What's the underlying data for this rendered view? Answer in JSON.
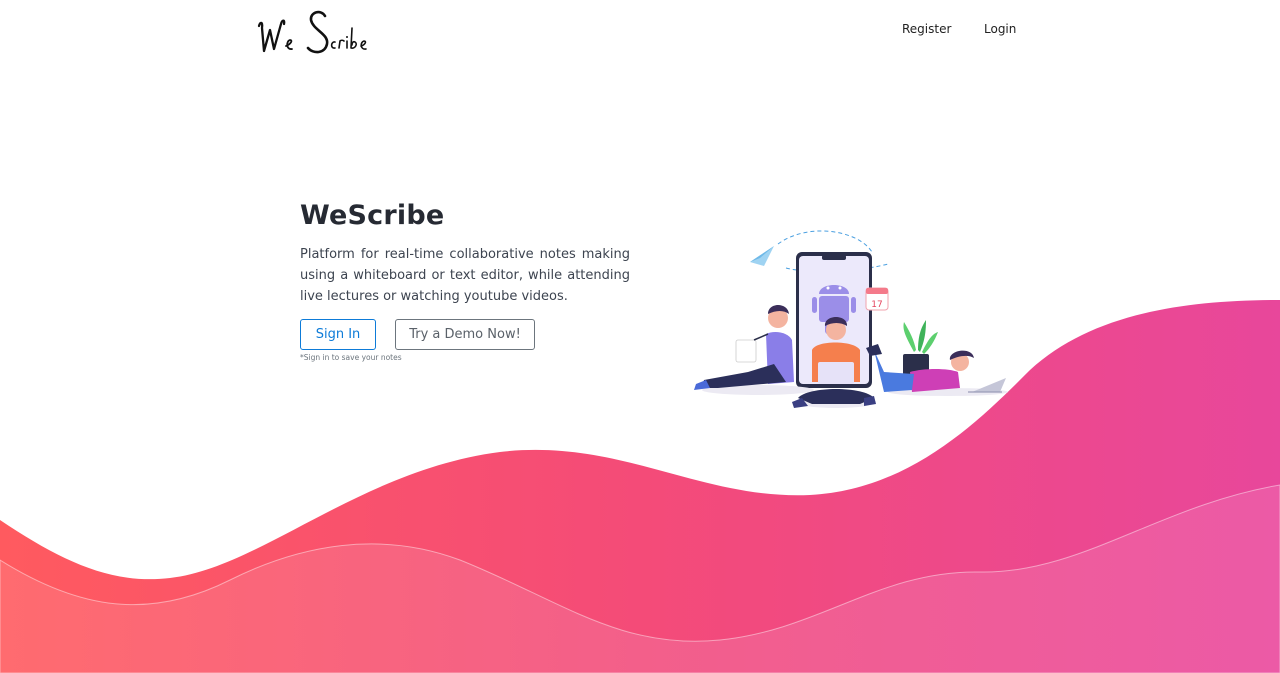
{
  "header": {
    "logo_text": "We Scribe",
    "nav": [
      {
        "label": "Register"
      },
      {
        "label": "Login"
      }
    ]
  },
  "hero": {
    "title": "WeScribe",
    "description": "Platform for real-time collaborative notes making using a whiteboard or text editor, while attending live lectures or watching youtube videos.",
    "signin_label": "Sign In",
    "demo_label": "Try a Demo Now!",
    "hint": "*Sign in to save your notes"
  },
  "illustration": {
    "calendar_number": "17"
  },
  "colors": {
    "primary": "#0d7bd8",
    "wave_start": "#ff5a5f",
    "wave_end": "#e8479b"
  }
}
